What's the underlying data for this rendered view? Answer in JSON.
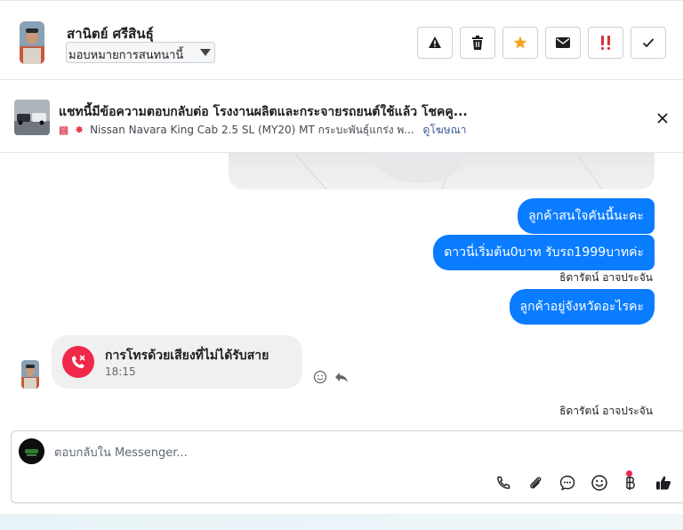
{
  "header": {
    "contact_name": "สานิตย์ ศรีสินธุ์",
    "assign_label": "มอบหมายการสนทนานี้",
    "actions": [
      {
        "name": "report-spam-button",
        "icon": "warning-icon"
      },
      {
        "name": "delete-button",
        "icon": "trash-icon"
      },
      {
        "name": "star-button",
        "icon": "star-icon"
      },
      {
        "name": "mark-unread-button",
        "icon": "envelope-icon"
      },
      {
        "name": "follow-up-button",
        "icon": "exclamation-icon"
      },
      {
        "name": "mark-done-button",
        "icon": "check-icon"
      }
    ]
  },
  "banner": {
    "title": "แชทนี้มีข้อความตอบกลับต่อ โรงงานผลิตและกระจายรถยนต์ใช้แล้ว โชคคู...",
    "subtitle": "Nissan Navara King Cab 2.5 SL (MY20) MT กระบะพันธุ์แกร่ง พ...",
    "link_text": "ดูโฆษณา"
  },
  "messages": {
    "out_1": "ลูกค้าสนใจคันนี้นะคะ",
    "out_2": "ดาวนี่เริ่มต้น0บาท รับรถ1999บาทค่ะ",
    "sender_1": "ธิดารัตน์ อาจประจัน",
    "out_3": "ลูกค้าอยู่จังหวัดอะไรคะ",
    "call_title": "การโทรด้วยเสียงที่ไม่ได้รับสาย",
    "call_time": "18:15",
    "sender_2": "ธิดารัตน์ อาจประจัน"
  },
  "composer": {
    "placeholder": "ตอบกลับใน Messenger...",
    "tools": [
      "phone-icon",
      "paperclip-icon",
      "saved-replies-icon",
      "emoji-icon",
      "baht-icon",
      "like-icon"
    ]
  },
  "colors": {
    "outgoing_bubble": "#0a7cff",
    "missed_call": "#f0284a",
    "star": "#f5a623",
    "follow_up": "#e02d3c"
  }
}
